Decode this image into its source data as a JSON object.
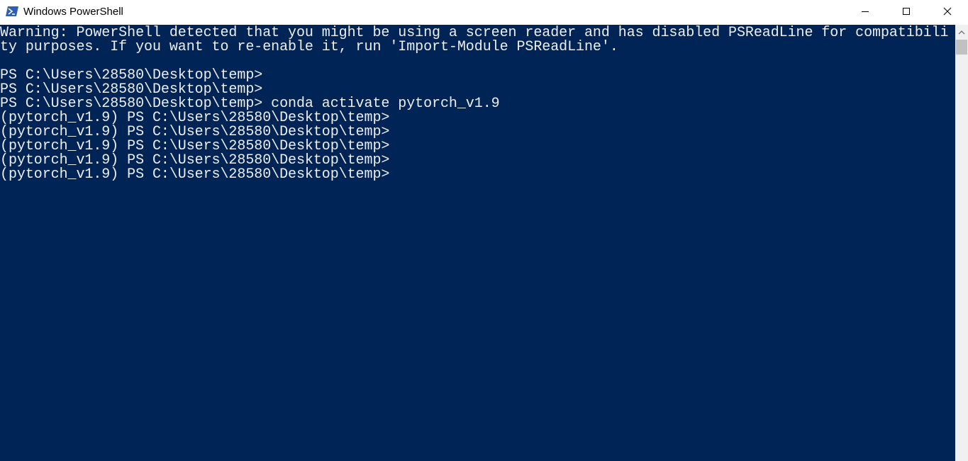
{
  "window": {
    "title": "Windows PowerShell",
    "background": "#012456",
    "foreground": "#eeeeee",
    "icon": "powershell-icon"
  },
  "titlebar": {
    "minimize": "minimize-icon",
    "maximize": "maximize-icon",
    "close": "close-icon"
  },
  "terminal": {
    "lines": [
      "Warning: PowerShell detected that you might be using a screen reader and has disabled PSReadLine for compatibili",
      "ty purposes. If you want to re-enable it, run 'Import-Module PSReadLine'.",
      "",
      "PS C:\\Users\\28580\\Desktop\\temp>",
      "PS C:\\Users\\28580\\Desktop\\temp>",
      "PS C:\\Users\\28580\\Desktop\\temp> conda activate pytorch_v1.9",
      "(pytorch_v1.9) PS C:\\Users\\28580\\Desktop\\temp>",
      "(pytorch_v1.9) PS C:\\Users\\28580\\Desktop\\temp>",
      "(pytorch_v1.9) PS C:\\Users\\28580\\Desktop\\temp>",
      "(pytorch_v1.9) PS C:\\Users\\28580\\Desktop\\temp>",
      "(pytorch_v1.9) PS C:\\Users\\28580\\Desktop\\temp>"
    ]
  }
}
